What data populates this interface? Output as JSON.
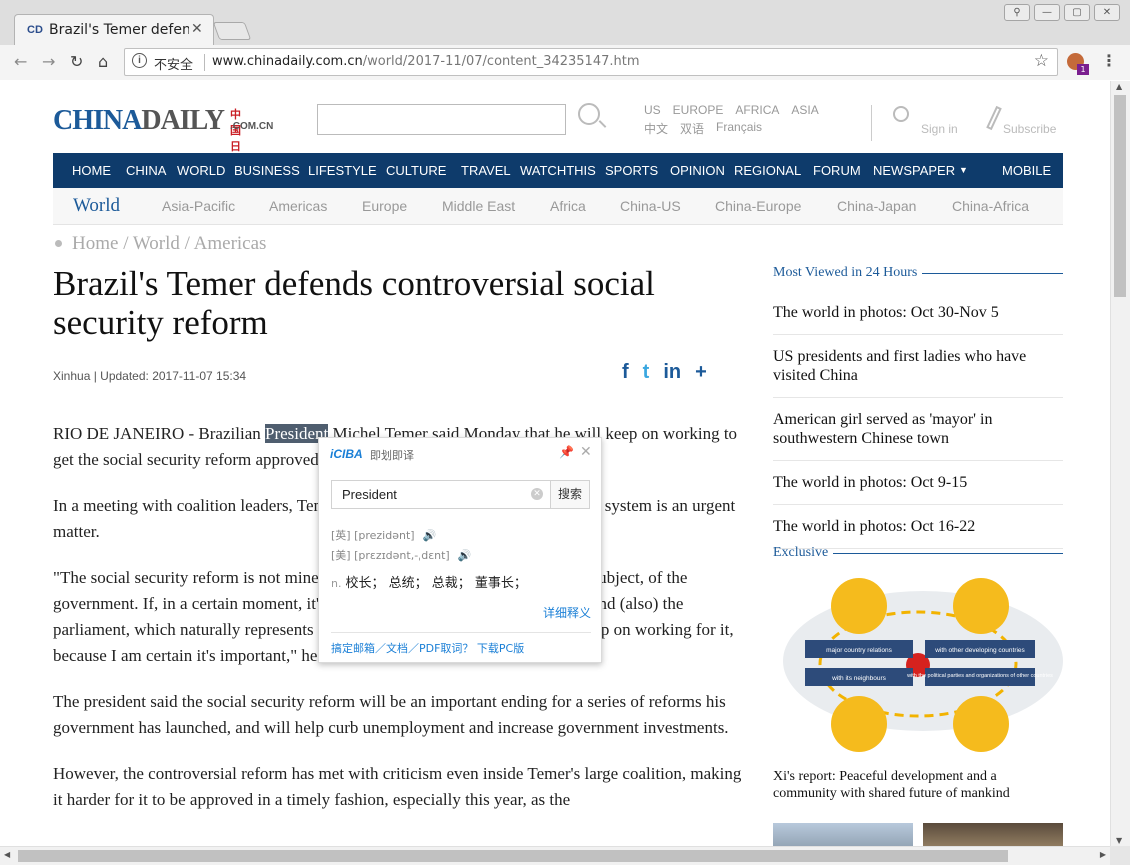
{
  "browser": {
    "tab_title": "Brazil's Temer defends controversial social security reform",
    "tab_favicon": "CD",
    "insecure_label": "不安全",
    "url_host": "www.chinadaily.com.cn",
    "url_path": "/world/2017-11/07/content_34235147.htm",
    "extension_badge": "1"
  },
  "site": {
    "logo_main": "CHINA",
    "logo_second": "DAILY",
    "logo_cn": "中国日报网",
    "logo_com": ".COM.CN",
    "editions_row1": [
      "US",
      "EUROPE",
      "AFRICA",
      "ASIA"
    ],
    "editions_row2": [
      "中文",
      "双语",
      "Français"
    ],
    "signin_label": "Sign in",
    "subscribe_label": "Subscribe",
    "main_nav": [
      "HOME",
      "CHINA",
      "WORLD",
      "BUSINESS",
      "LIFESTYLE",
      "CULTURE",
      "TRAVEL",
      "WATCHTHIS",
      "SPORTS",
      "OPINION",
      "REGIONAL",
      "FORUM",
      "NEWSPAPER",
      "MOBILE"
    ],
    "section_title": "World",
    "sub_nav": [
      "Asia-Pacific",
      "Americas",
      "Europe",
      "Middle East",
      "Africa",
      "China-US",
      "China-Europe",
      "China-Japan",
      "China-Africa"
    ]
  },
  "article": {
    "breadcrumb": [
      "Home",
      "World",
      "Americas"
    ],
    "headline": "Brazil's Temer defends controversial social security reform",
    "byline": "Xinhua | Updated: 2017-11-07 15:34",
    "share": [
      "f",
      "t",
      "in",
      "+"
    ],
    "p1_before": "RIO DE JANEIRO - Brazilian ",
    "p1_highlight": "President",
    "p1_after": " Michel Temer said Monday that he will keep on working to get the social security reform approved even though the majority opposes it.",
    "p2": "In a meeting with coalition leaders, Temer said that reforming the social security system is an urgent matter.",
    "p3": "\"The social security reform is not mine, it's not my government's, it is a shared subject, of the government. If, in a certain moment, it's clear that the society does not want it, and (also) the parliament, which naturally represents the society, does not approve it. I will keep on working for it, because I am certain it's important,\" he said.",
    "p4": "The president said the social security reform will be an important ending for a series of reforms his government has launched, and will help curb unemployment and increase government investments.",
    "p5": "However, the controversial reform has met with criticism even inside Temer's large coalition, making it harder for it to be approved in a timely fashion, especially this year, as the"
  },
  "sidebar": {
    "most_viewed_title": "Most Viewed in 24 Hours",
    "most_viewed": [
      "The world in photos: Oct 30-Nov 5",
      "US presidents and first ladies who have visited China",
      "American girl served as 'mayor' in southwestern Chinese town",
      "The world in photos: Oct 9-15",
      "The world in photos: Oct 16-22"
    ],
    "exclusive_title": "Exclusive",
    "infographic_labels": [
      "major country relations",
      "with other developing countries",
      "with its neighbours",
      "with the political parties and organizations of other countries"
    ],
    "exclusive_caption": "Xi's report: Peaceful development and a community with shared future of mankind"
  },
  "iciba": {
    "brand": "iCIBA",
    "brand_sub": "即划即译",
    "word": "President",
    "search_label": "搜索",
    "phon_uk": "[英] [prezidənt]",
    "phon_us": "[美] [prɛzɪdənt,-ˌdɛnt]",
    "pos": "n.",
    "definition": "校长；  总统；  总裁；  董事长；",
    "more_label": "详细释义",
    "footer": "搞定邮箱／文档／PDF取词？ 下载PC版"
  }
}
